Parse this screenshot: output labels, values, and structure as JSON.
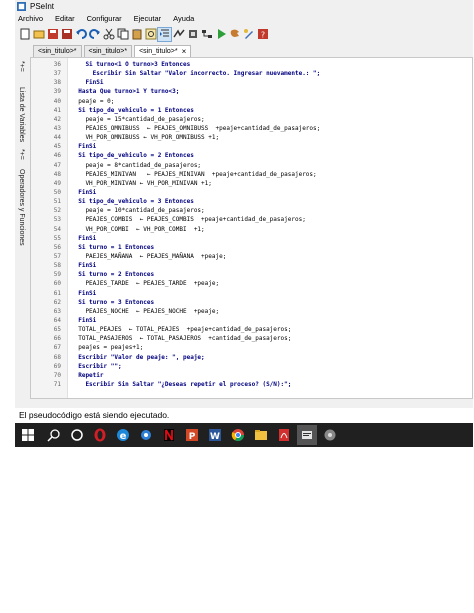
{
  "window": {
    "title": "PSeInt"
  },
  "menu": [
    "Archivo",
    "Editar",
    "Configurar",
    "Ejecutar",
    "Ayuda"
  ],
  "tabs": [
    {
      "label": "<sin_titulo>*",
      "active": false
    },
    {
      "label": "<sin_titulo>*",
      "active": false
    },
    {
      "label": "<sin_titulo>*",
      "active": true
    }
  ],
  "tab_close": "×",
  "side_panels": [
    "Lista de Variables",
    "Operadores y Funciones"
  ],
  "side_symbols": [
    "*+=",
    "*+="
  ],
  "code_lines": [
    {
      "n": "36",
      "text": "    Si turno<1 O turno>3 Entonces"
    },
    {
      "n": "37",
      "text": "      Escribir Sin Saltar \"Valor incorrecto. Ingresar nuevamente.: \";"
    },
    {
      "n": "38",
      "text": "    FinSi"
    },
    {
      "n": "39",
      "text": "  Hasta Que turno>1 Y turno<3;"
    },
    {
      "n": "40",
      "text": "  peaje = 0;"
    },
    {
      "n": "41",
      "text": "  Si tipo_de_vehiculo = 1 Entonces"
    },
    {
      "n": "42",
      "text": "    peaje = 15*cantidad_de_pasajeros;"
    },
    {
      "n": "43",
      "text": "    PEAJES_OMNIBUSS  ← PEAJES_OMNIBUSS  +peaje+cantidad_de_pasajeros;"
    },
    {
      "n": "44",
      "text": "    VH_POR_OMNIBUSS ← VH_POR_OMNIBUSS +1;"
    },
    {
      "n": "45",
      "text": "  FinSi"
    },
    {
      "n": "46",
      "text": "  Si tipo_de_vehiculo = 2 Entonces"
    },
    {
      "n": "47",
      "text": "    peaje = 8*cantidad_de_pasajeros;"
    },
    {
      "n": "48",
      "text": "    PEAJES_MINIVAN   ← PEAJES_MINIVAN  +peaje+cantidad_de_pasajeros;"
    },
    {
      "n": "49",
      "text": "    VH_POR_MINIVAN ← VH_POR_MINIVAN +1;"
    },
    {
      "n": "50",
      "text": "  FinSi"
    },
    {
      "n": "51",
      "text": "  Si tipo_de_vehiculo = 3 Entonces"
    },
    {
      "n": "52",
      "text": "    peaje = 10*cantidad_de_pasajeros;"
    },
    {
      "n": "53",
      "text": "    PEAJES_COMBIS  ← PEAJES_COMBIS  +peaje+cantidad_de_pasajeros;"
    },
    {
      "n": "54",
      "text": "    VH_POR_COMBI  ← VH_POR_COMBI  +1;"
    },
    {
      "n": "55",
      "text": "  FinSi"
    },
    {
      "n": "56",
      "text": "  Si turno = 1 Entonces"
    },
    {
      "n": "57",
      "text": "    PAEJES_MAÑANA  ← PEAJES_MAÑANA  +peaje;"
    },
    {
      "n": "58",
      "text": "  FinSi"
    },
    {
      "n": "59",
      "text": "  Si turno = 2 Entonces"
    },
    {
      "n": "60",
      "text": "    PEAJES_TARDE  ← PEAJES_TARDE  +peaje;"
    },
    {
      "n": "61",
      "text": "  FinSi"
    },
    {
      "n": "62",
      "text": "  Si turno = 3 Entonces"
    },
    {
      "n": "63",
      "text": "    PEAJES_NOCHE  ← PEAJES_NOCHE  +peaje;"
    },
    {
      "n": "64",
      "text": "  FinSi"
    },
    {
      "n": "65",
      "text": "  TOTAL_PEAJES  ← TOTAL_PEAJES  +peaje+cantidad_de_pasajeros;"
    },
    {
      "n": "66",
      "text": "  TOTAL_PASAJEROS  ← TOTAL_PASAJEROS  +cantidad_de_pasajeros;"
    },
    {
      "n": "67",
      "text": "  peajes = peajes+1;"
    },
    {
      "n": "68",
      "text": "  Escribir \"Valor de peaje: \", peaje;"
    },
    {
      "n": "69",
      "text": "  Escribir \"\";"
    },
    {
      "n": "70",
      "text": "  Repetir"
    },
    {
      "n": "71",
      "text": "    Escribir Sin Saltar \"¿Deseas repetir el proceso? (S/N):\";"
    }
  ],
  "status": "El pseudocódigo está siendo ejecutado.",
  "colors": {
    "keyword": "#000080",
    "taskbar": "#202020",
    "status_text": "#000000"
  },
  "toolbar_icons": [
    "new-file-icon",
    "open-icon",
    "save-icon",
    "save-as-icon",
    "undo-icon",
    "redo-icon",
    "cut-icon",
    "copy-icon",
    "paste-icon",
    "find-icon",
    "indent-icon",
    "run-step-icon",
    "debug-icon",
    "flowchart-icon",
    "run-icon",
    "step-icon",
    "draw-icon",
    "help-icon"
  ],
  "taskbar_icons": [
    "windows-start-icon",
    "search-icon",
    "task-view-icon",
    "opera-icon",
    "edge-icon",
    "app-icon",
    "netflix-icon",
    "powerpoint-icon",
    "word-icon",
    "chrome-icon",
    "file-explorer-icon",
    "pdf-icon",
    "pseint-icon",
    "app-icon-2"
  ]
}
